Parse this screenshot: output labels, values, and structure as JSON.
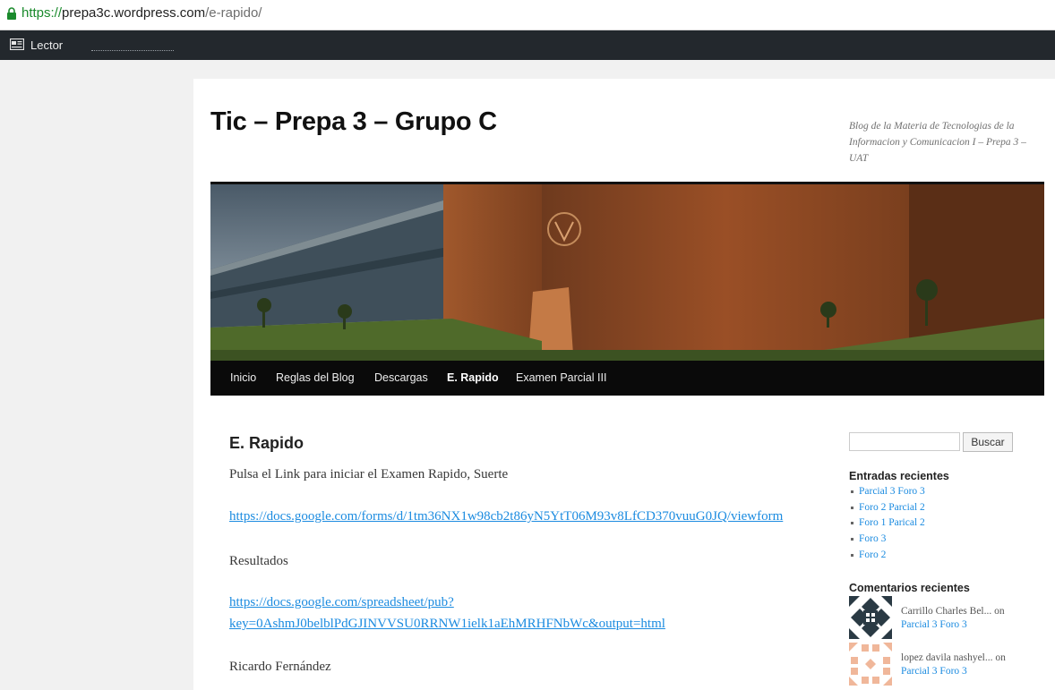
{
  "browser": {
    "url_scheme": "https://",
    "url_host": "prepa3c.wordpress.com",
    "url_path": "/e-rapido/"
  },
  "adminbar": {
    "reader_label": "Lector",
    "reader_icon": "reader-icon"
  },
  "site": {
    "title": "Tic – Prepa 3 – Grupo C",
    "description": "Blog de la Materia de Tecnologias de la Informacion y Comunicacion I – Prepa 3 – UAT"
  },
  "nav": {
    "items": [
      "Inicio",
      "Reglas del Blog",
      "Descargas",
      "E. Rapido",
      "Examen Parcial III"
    ],
    "active": "E. Rapido"
  },
  "entry": {
    "title": "E. Rapido",
    "intro": "Pulsa el Link para iniciar el Examen Rapido, Suerte",
    "form_link": "https://docs.google.com/forms/d/1tm36NX1w98cb2t86yN5YtT06M93v8LfCD370vuuG0JQ/viewform",
    "results_label": "Resultados",
    "results_link_line1": "https://docs.google.com/spreadsheet/pub?",
    "results_link_line2": "key=0AshmJ0belblPdGJINVVSU0RRNW1ielk1aEhMRHFNbWc&output=html",
    "author": "Ricardo Fernández"
  },
  "sidebar": {
    "search_button": "Buscar",
    "search_value": "",
    "recent_posts_title": "Entradas recientes",
    "recent_posts": [
      "Parcial 3 Foro 3",
      "Foro 2 Parcial 2",
      "Foro 1 Parical 2",
      "Foro 3",
      "Foro 2"
    ],
    "recent_comments_title": "Comentarios recientes",
    "comments": [
      {
        "author": "Carrillo Charles Bel...",
        "on": "on",
        "post": "Parcial 3 Foro 3"
      },
      {
        "author": "lopez davila nashyel...",
        "on": "on",
        "post": "Parcial 3 Foro 3"
      }
    ]
  },
  "colors": {
    "adminbar": "#23282d",
    "nav": "#0a0a0a",
    "link": "#1b8be0",
    "secure": "#1a8a2c"
  }
}
